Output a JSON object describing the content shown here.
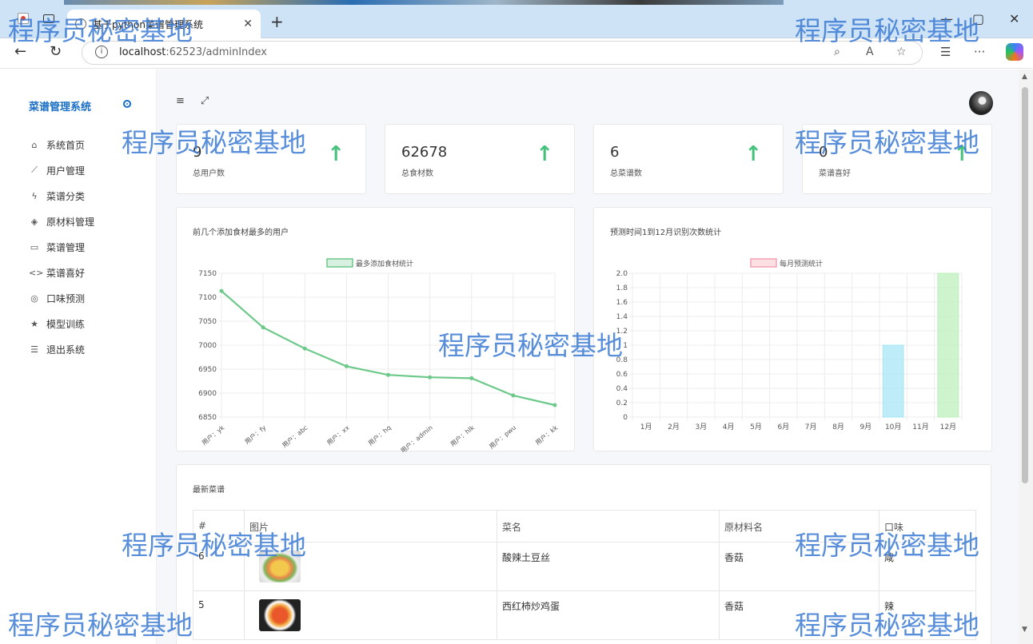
{
  "browser": {
    "tab_title": "基于python菜谱管理系统",
    "url_host": "localhost",
    "url_rest": ":62523/adminIndex"
  },
  "sidebar": {
    "brand": "菜谱管理系统",
    "items": [
      {
        "label": "系统首页",
        "icon": "home-icon"
      },
      {
        "label": "用户管理",
        "icon": "trend-icon"
      },
      {
        "label": "菜谱分类",
        "icon": "bolt-icon"
      },
      {
        "label": "原材料管理",
        "icon": "layers-icon"
      },
      {
        "label": "菜谱管理",
        "icon": "tablet-icon"
      },
      {
        "label": "菜谱喜好",
        "icon": "code-icon"
      },
      {
        "label": "口味预测",
        "icon": "target-icon"
      },
      {
        "label": "模型训练",
        "icon": "star-icon"
      },
      {
        "label": "退出系统",
        "icon": "list-icon"
      }
    ]
  },
  "stats": [
    {
      "value": "9",
      "label": "总用户数"
    },
    {
      "value": "62678",
      "label": "总食材数"
    },
    {
      "value": "6",
      "label": "总菜谱数"
    },
    {
      "value": "0",
      "label": "菜谱喜好"
    }
  ],
  "chart_left_title": "前几个添加食材最多的用户",
  "chart_right_title": "预测时间1到12月识别次数统计",
  "chart_data": [
    {
      "type": "line",
      "legend": "最多添加食材统计",
      "categories": [
        "用户：yk",
        "用户：fy",
        "用户：abc",
        "用户：xx",
        "用户：hq",
        "用户：admin",
        "用户：hlk",
        "用户：pwu",
        "用户：kk"
      ],
      "values": [
        7113,
        7037,
        6993,
        6956,
        6938,
        6933,
        6931,
        6895,
        6875
      ],
      "ylim": [
        6850,
        7150
      ],
      "yticks": [
        6850,
        6900,
        6950,
        7000,
        7050,
        7100,
        7150
      ],
      "color": "#6cc98a"
    },
    {
      "type": "bar",
      "legend": "每月预测统计",
      "categories": [
        "1月",
        "2月",
        "3月",
        "4月",
        "5月",
        "6月",
        "7月",
        "8月",
        "9月",
        "10月",
        "11月",
        "12月"
      ],
      "values": [
        0,
        0,
        0,
        0,
        0,
        0,
        0,
        0,
        0,
        1,
        0,
        2
      ],
      "ylim": [
        0,
        2
      ],
      "yticks": [
        "0",
        "0.2",
        "0.4",
        "0.6",
        "0.8",
        "1",
        "1.2",
        "1.4",
        "1.6",
        "1.8",
        "2.0"
      ],
      "colors": [
        "#f4a3b4",
        "#f8c28a",
        "#f6dd8a",
        "#9fdcdc",
        "#9cc9f2",
        "#c8b1f0",
        "#d9d9d9",
        "#f4a3b4",
        "#f8c28a",
        "#a8e6f5",
        "#e7b8f0",
        "#bdf0bd"
      ]
    }
  ],
  "recent": {
    "title": "最新菜谱",
    "headers": [
      "#",
      "图片",
      "菜名",
      "原材料名",
      "口味"
    ],
    "rows": [
      {
        "id": "6",
        "name": "酸辣土豆丝",
        "material": "香菇",
        "taste": "咸"
      },
      {
        "id": "5",
        "name": "西红柿炒鸡蛋",
        "material": "香菇",
        "taste": "辣"
      }
    ]
  },
  "watermark": "程序员秘密基地"
}
